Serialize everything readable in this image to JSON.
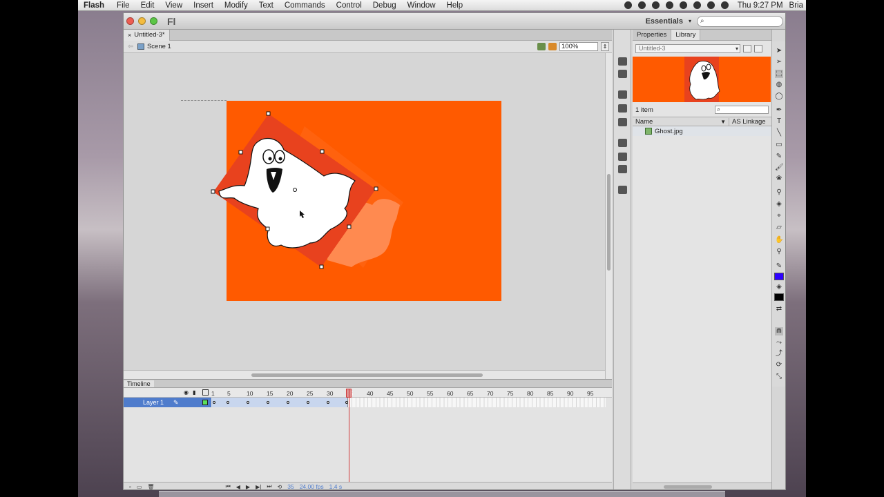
{
  "menubar": {
    "app_name": "Flash",
    "items": [
      "File",
      "Edit",
      "View",
      "Insert",
      "Modify",
      "Text",
      "Commands",
      "Control",
      "Debug",
      "Window",
      "Help"
    ],
    "clock": "Thu 9:27 PM",
    "user": "Bria"
  },
  "window": {
    "logo": "Fl",
    "workspace": "Essentials",
    "search_placeholder": ""
  },
  "document": {
    "tab_title": "Untitled-3*",
    "scene": "Scene 1",
    "zoom": "100%"
  },
  "library": {
    "tabs": [
      "Properties",
      "Library"
    ],
    "doc_name": "Untitled-3",
    "item_count": "1 item",
    "col_name": "Name",
    "col_linkage": "AS Linkage",
    "items": [
      {
        "name": "Ghost.jpg"
      }
    ]
  },
  "timeline": {
    "tab": "Timeline",
    "layer_name": "Layer 1",
    "ruler": [
      "1",
      "5",
      "10",
      "15",
      "20",
      "25",
      "30",
      "35",
      "40",
      "45",
      "50",
      "55",
      "60",
      "65",
      "70",
      "75",
      "80",
      "85",
      "90",
      "95"
    ],
    "current_frame": "35",
    "fps": "24.00 fps",
    "time": "1.4 s"
  },
  "colors": {
    "stage": "#ff5a00",
    "ghost_box": "#e8421e",
    "tween_ghost": "#ff8a50",
    "stroke_swatch": "#2d00ff",
    "fill_swatch": "#000000",
    "layer_highlight": "#4f7ccc"
  }
}
